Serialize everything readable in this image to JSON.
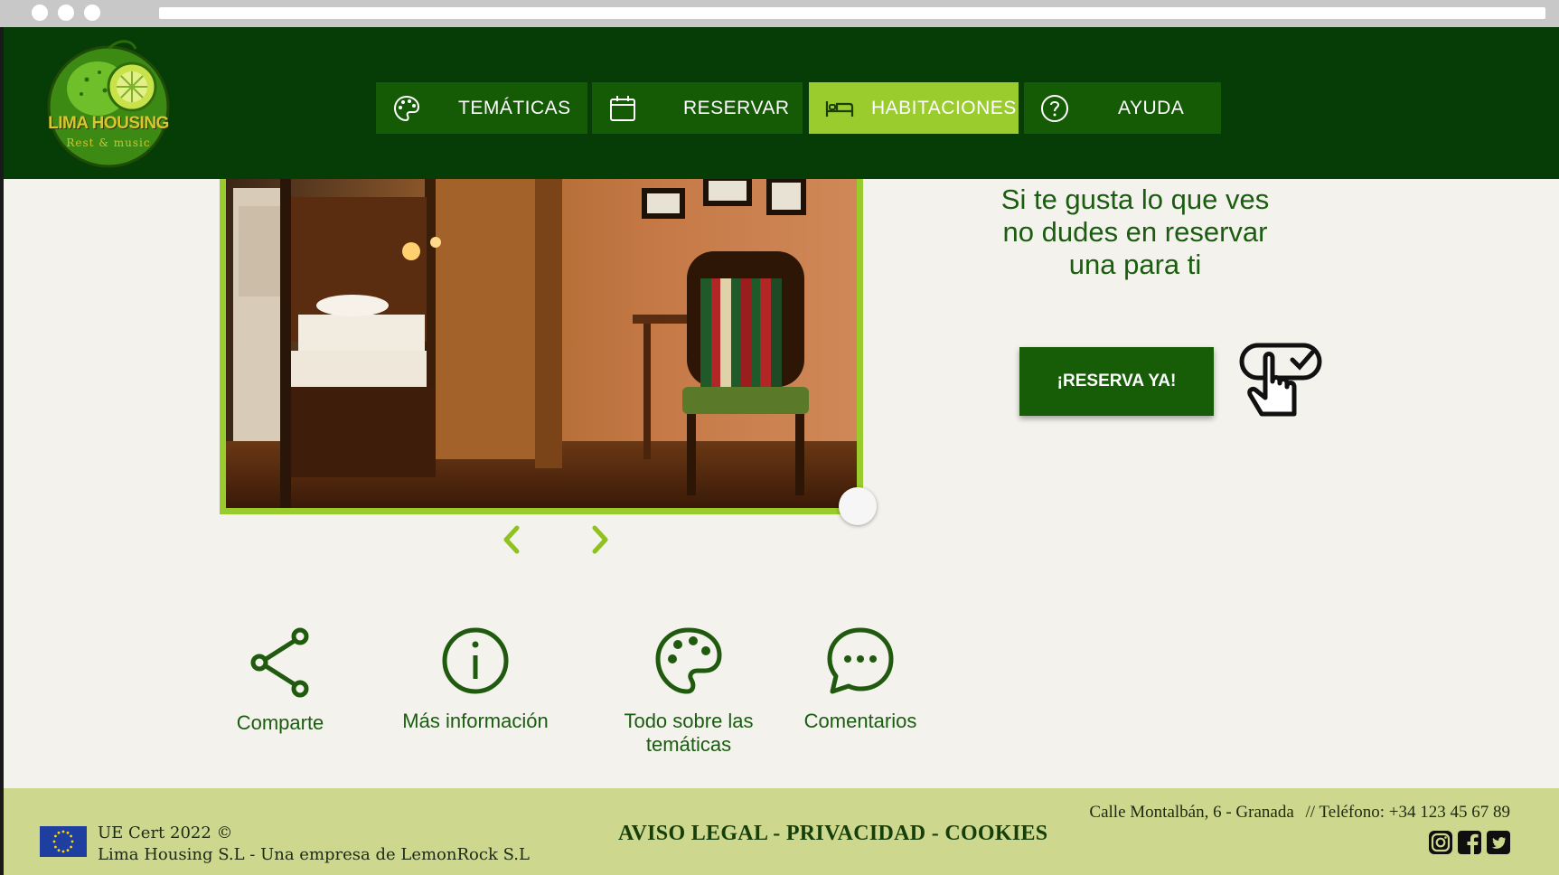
{
  "header": {
    "logo_name": "LIMA HOUSING",
    "logo_tagline": "Rest & music",
    "nav": [
      {
        "label": "TEMÁTICAS",
        "icon": "palette-icon"
      },
      {
        "label": "RESERVAR",
        "icon": "calendar-icon"
      },
      {
        "label": "HABITACIONES",
        "icon": "bed-icon",
        "active": true
      },
      {
        "label": "AYUDA",
        "icon": "help-circle-icon"
      }
    ]
  },
  "gallery": {
    "image": "bunk-bed-room-photo",
    "prev_icon": "chevron-left-icon",
    "next_icon": "chevron-right-icon"
  },
  "promo": {
    "line1": "Si te gusta lo que ves",
    "line2": "no dudes en reservar",
    "line3": "una para ti",
    "button_label": "¡RESERVA YA!",
    "icon": "tap-check-icon"
  },
  "actions": [
    {
      "label": "Comparte",
      "icon": "share-icon"
    },
    {
      "label": "Más información",
      "icon": "info-icon"
    },
    {
      "label": "Todo sobre las temáticas",
      "icon": "palette-icon"
    },
    {
      "label": "Comentarios",
      "icon": "chat-bubble-icon"
    }
  ],
  "footer": {
    "cert": "UE Cert 2022 ©",
    "company": "Lima Housing S.L - Una empresa de LemonRock S.L",
    "links": [
      "AVISO LEGAL",
      "PRIVACIDAD",
      "COOKIES"
    ],
    "separator": " - ",
    "address": "Calle Montalbán, 6 - Granada",
    "phone_sep": "//",
    "phone": "Teléfono: +34 123 45 67 89",
    "social": [
      "instagram-icon",
      "facebook-icon",
      "twitter-icon"
    ]
  },
  "colors": {
    "header_bg": "#063d06",
    "nav_bg": "#155b06",
    "nav_active": "#99cc2c",
    "accent_green": "#9acb2c",
    "text_green": "#1a5c10",
    "footer_bg": "#cdd78d",
    "page_bg": "#f4f2ec"
  }
}
